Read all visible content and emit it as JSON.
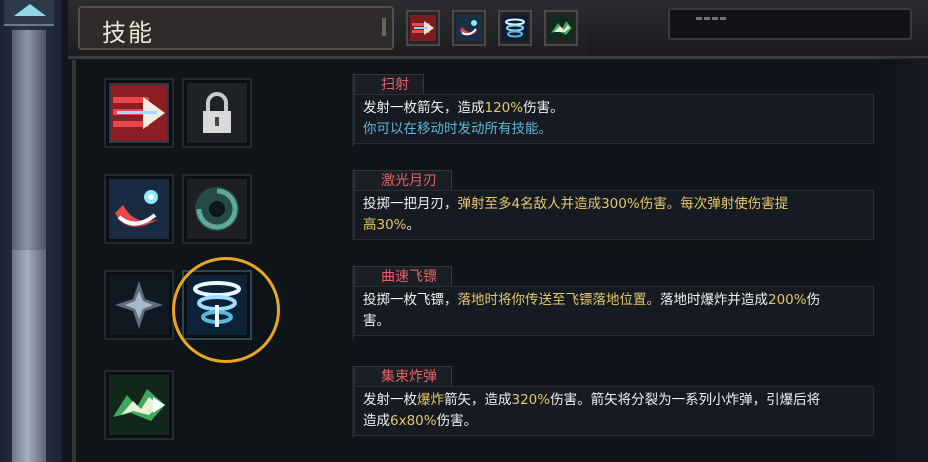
{
  "window": {
    "title": "技能"
  },
  "header_tabs": [
    {
      "icon": "arrow-dash-icon"
    },
    {
      "icon": "moon-blade-icon"
    },
    {
      "icon": "curved-dart-icon"
    },
    {
      "icon": "cluster-bomb-icon"
    }
  ],
  "skills": [
    {
      "name": "扫射",
      "line1_a": "发射一枚箭矢，造成",
      "line1_b": "120%",
      "line1_c": "伤害。",
      "line2": "你可以在移动时发动所有技能。",
      "slot_left_icon": "arrow-dash-icon",
      "slot_right_icon": "lock-icon",
      "slot_right_state": "locked"
    },
    {
      "name": "激光月刃",
      "line1_a": "投掷一把月刃，",
      "line1_b": "弹射至多4名敌人并造成",
      "line1_c": "300%",
      "line1_d": "伤害。",
      "line1_e": "每次弹射使伤害提",
      "line2_a": "高",
      "line2_b": "30%",
      "line2_c": "。",
      "slot_left_icon": "moon-blade-icon",
      "slot_right_icon": "vortex-icon"
    },
    {
      "name": "曲速飞镖",
      "line1_a": "投掷一枚飞镖，",
      "line1_b": "落地时将你传送至飞镖落地位置。",
      "line1_c": "落地时爆炸并造成",
      "line1_d": "200%",
      "line1_e": "伤",
      "line2": "害。",
      "slot_left_icon": "spark-burst-icon",
      "slot_right_icon": "curved-dart-icon",
      "slot_right_state": "selected"
    },
    {
      "name": "集束炸弹",
      "line1_a": "发射一枚",
      "line1_b": "爆炸",
      "line1_c": "箭矢，造成",
      "line1_d": "320%",
      "line1_e": "伤害。箭矢将分裂为一系列小炸弹，引爆后将",
      "line2_a": "造成",
      "line2_b": "6x80%",
      "line2_c": "伤害。",
      "slot_left_icon": "cluster-bomb-icon"
    }
  ],
  "colors": {
    "skill_name": "#e85f66",
    "highlight": "#e5c66a",
    "info": "#5fb6d7",
    "selection_ring": "#e8a721"
  }
}
